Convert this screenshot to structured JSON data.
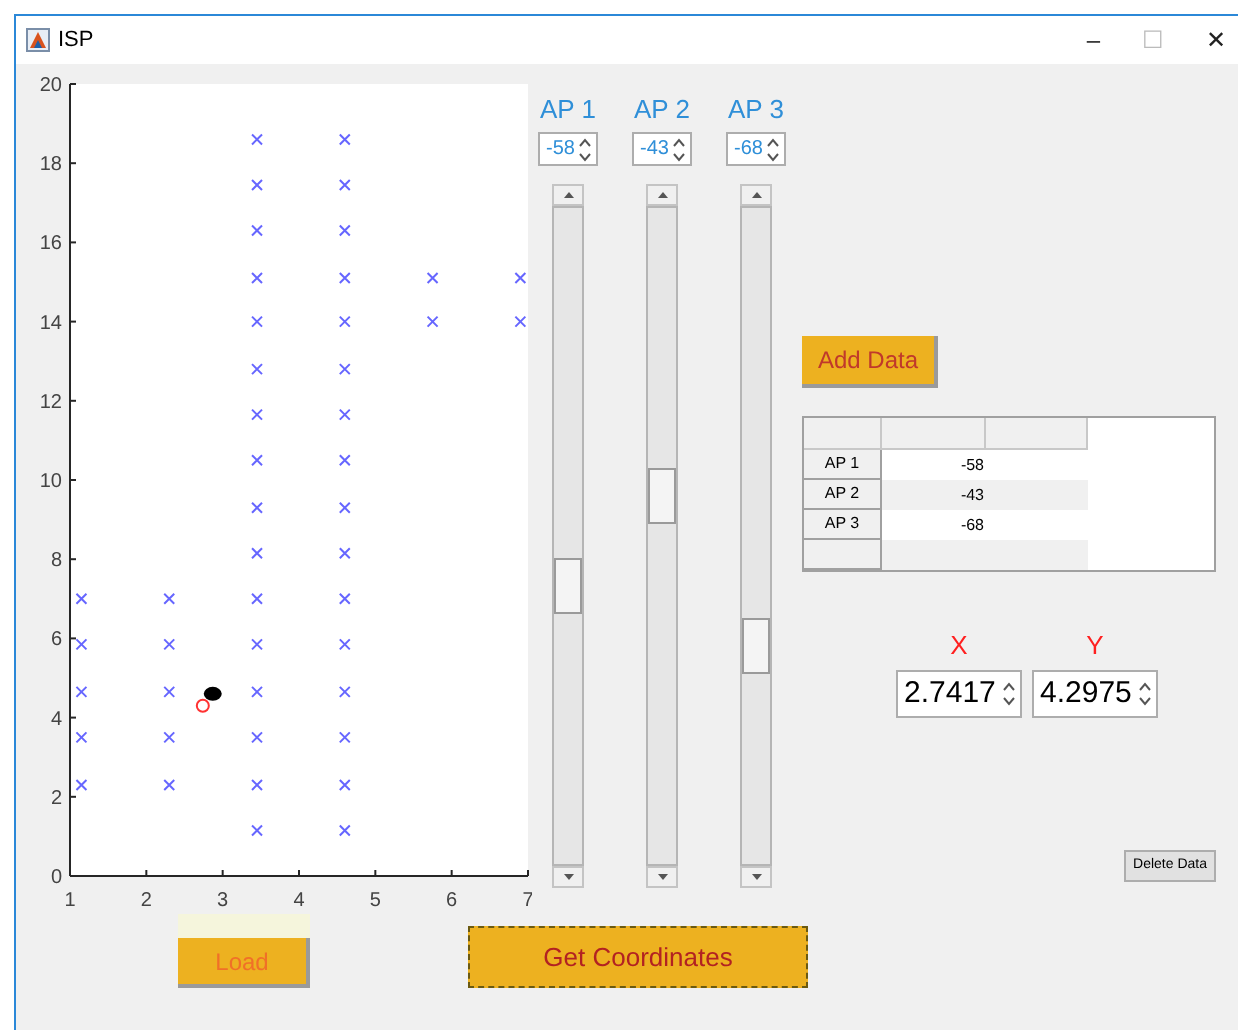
{
  "window": {
    "title": "ISP",
    "controls": [
      "–",
      "☐",
      "✕"
    ]
  },
  "plot": {
    "chart_data": {
      "type": "scatter",
      "xlim": [
        1,
        7
      ],
      "ylim": [
        0,
        20
      ],
      "xticks": [
        1,
        2,
        3,
        4,
        5,
        6,
        7
      ],
      "yticks": [
        0,
        2,
        4,
        6,
        8,
        10,
        12,
        14,
        16,
        18,
        20
      ],
      "series": [
        {
          "color": "#6666ff",
          "marker": "x",
          "x": [
            1.15,
            1.15,
            1.15,
            1.15,
            1.15,
            2.3,
            2.3,
            2.3,
            2.3,
            2.3,
            3.45,
            3.45,
            3.45,
            3.45,
            3.45,
            3.45,
            3.45,
            3.45,
            3.45,
            3.45,
            3.45,
            3.45,
            3.45,
            3.45,
            3.45,
            3.45,
            4.6,
            4.6,
            4.6,
            4.6,
            4.6,
            4.6,
            4.6,
            4.6,
            4.6,
            4.6,
            4.6,
            4.6,
            4.6,
            4.6,
            4.6,
            4.6,
            5.75,
            5.75,
            6.9,
            6.9
          ],
          "values": [
            7,
            5.85,
            4.65,
            3.5,
            2.3,
            7,
            5.85,
            4.65,
            3.5,
            2.3,
            18.6,
            17.45,
            16.3,
            15.1,
            14,
            12.8,
            11.65,
            10.5,
            9.3,
            8.15,
            7,
            5.85,
            4.65,
            3.5,
            2.3,
            1.15,
            18.6,
            17.45,
            16.3,
            15.1,
            14,
            12.8,
            11.65,
            10.5,
            9.3,
            8.15,
            7,
            5.85,
            4.65,
            3.5,
            2.3,
            1.15,
            15.1,
            14,
            15.1,
            14
          ]
        },
        {
          "color": "#ff3333",
          "marker": "circle",
          "x": [
            2.74
          ],
          "values": [
            4.3
          ]
        },
        {
          "color": "#000000",
          "marker": "dot",
          "x": [
            2.87
          ],
          "values": [
            4.6
          ]
        }
      ]
    }
  },
  "access_points": [
    {
      "label": "AP 1",
      "value": "-58",
      "level": 0.42
    },
    {
      "label": "AP 2",
      "value": "-43",
      "level": 0.57
    },
    {
      "label": "AP 3",
      "value": "-68",
      "level": 0.32
    }
  ],
  "add_data_button": "Add Data",
  "table": {
    "rows": [
      {
        "header": "AP 1",
        "value": "-58"
      },
      {
        "header": "AP 2",
        "value": "-43"
      },
      {
        "header": "AP 3",
        "value": "-68"
      }
    ]
  },
  "coordinates": [
    {
      "label": "X",
      "value": "2.7417"
    },
    {
      "label": "Y",
      "value": "4.2975"
    }
  ],
  "delete_data_button": "Delete Data",
  "load_button": "Load",
  "get_coordinates_button": "Get Coordinates"
}
